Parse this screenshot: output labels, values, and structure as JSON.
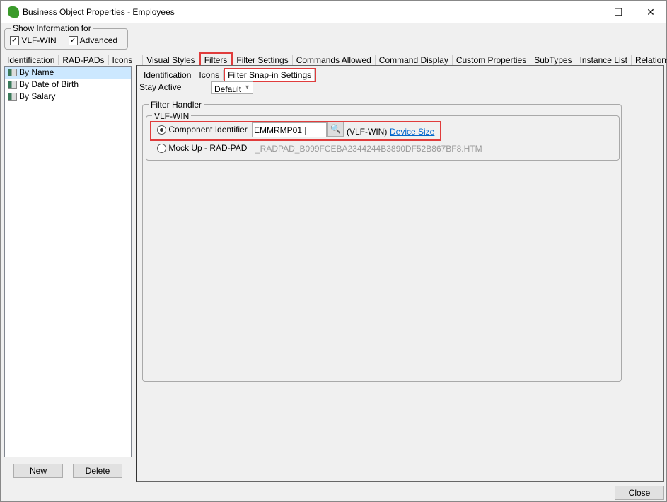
{
  "window": {
    "title": "Business Object Properties - Employees",
    "minimize": "—",
    "maximize": "☐",
    "close": "✕"
  },
  "show_info": {
    "legend": "Show Information for",
    "vlf_win": "VLF-WIN",
    "advanced": "Advanced",
    "check": "✓"
  },
  "tabs": [
    "Identification",
    "RAD-PADs",
    "Icons",
    "Visual Styles",
    "Filters",
    "Filter Settings",
    "Commands Allowed",
    "Command Display",
    "Custom Properties",
    "SubTypes",
    "Instance List",
    "Relationships"
  ],
  "filters": [
    "By Name",
    "By Date of Birth",
    "By Salary"
  ],
  "list_buttons": {
    "new": "New",
    "delete": "Delete"
  },
  "subtabs": [
    "Identification",
    "Icons",
    "Filter Snap-in Settings"
  ],
  "stay_active": {
    "label": "Stay Active",
    "value": "Default",
    "arrow": "▾"
  },
  "filter_handler": {
    "legend": "Filter Handler",
    "vlf_legend": "VLF-WIN",
    "component_label": "Component Identifier",
    "component_value": "EMMRMP01",
    "platform": "(VLF-WIN)",
    "device_size": "Device Size",
    "mockup_label": "Mock Up - RAD-PAD",
    "mockup_file": "_RADPAD_B099FCEBA2344244B3890DF52B867BF8.HTM"
  },
  "close_button": "Close"
}
